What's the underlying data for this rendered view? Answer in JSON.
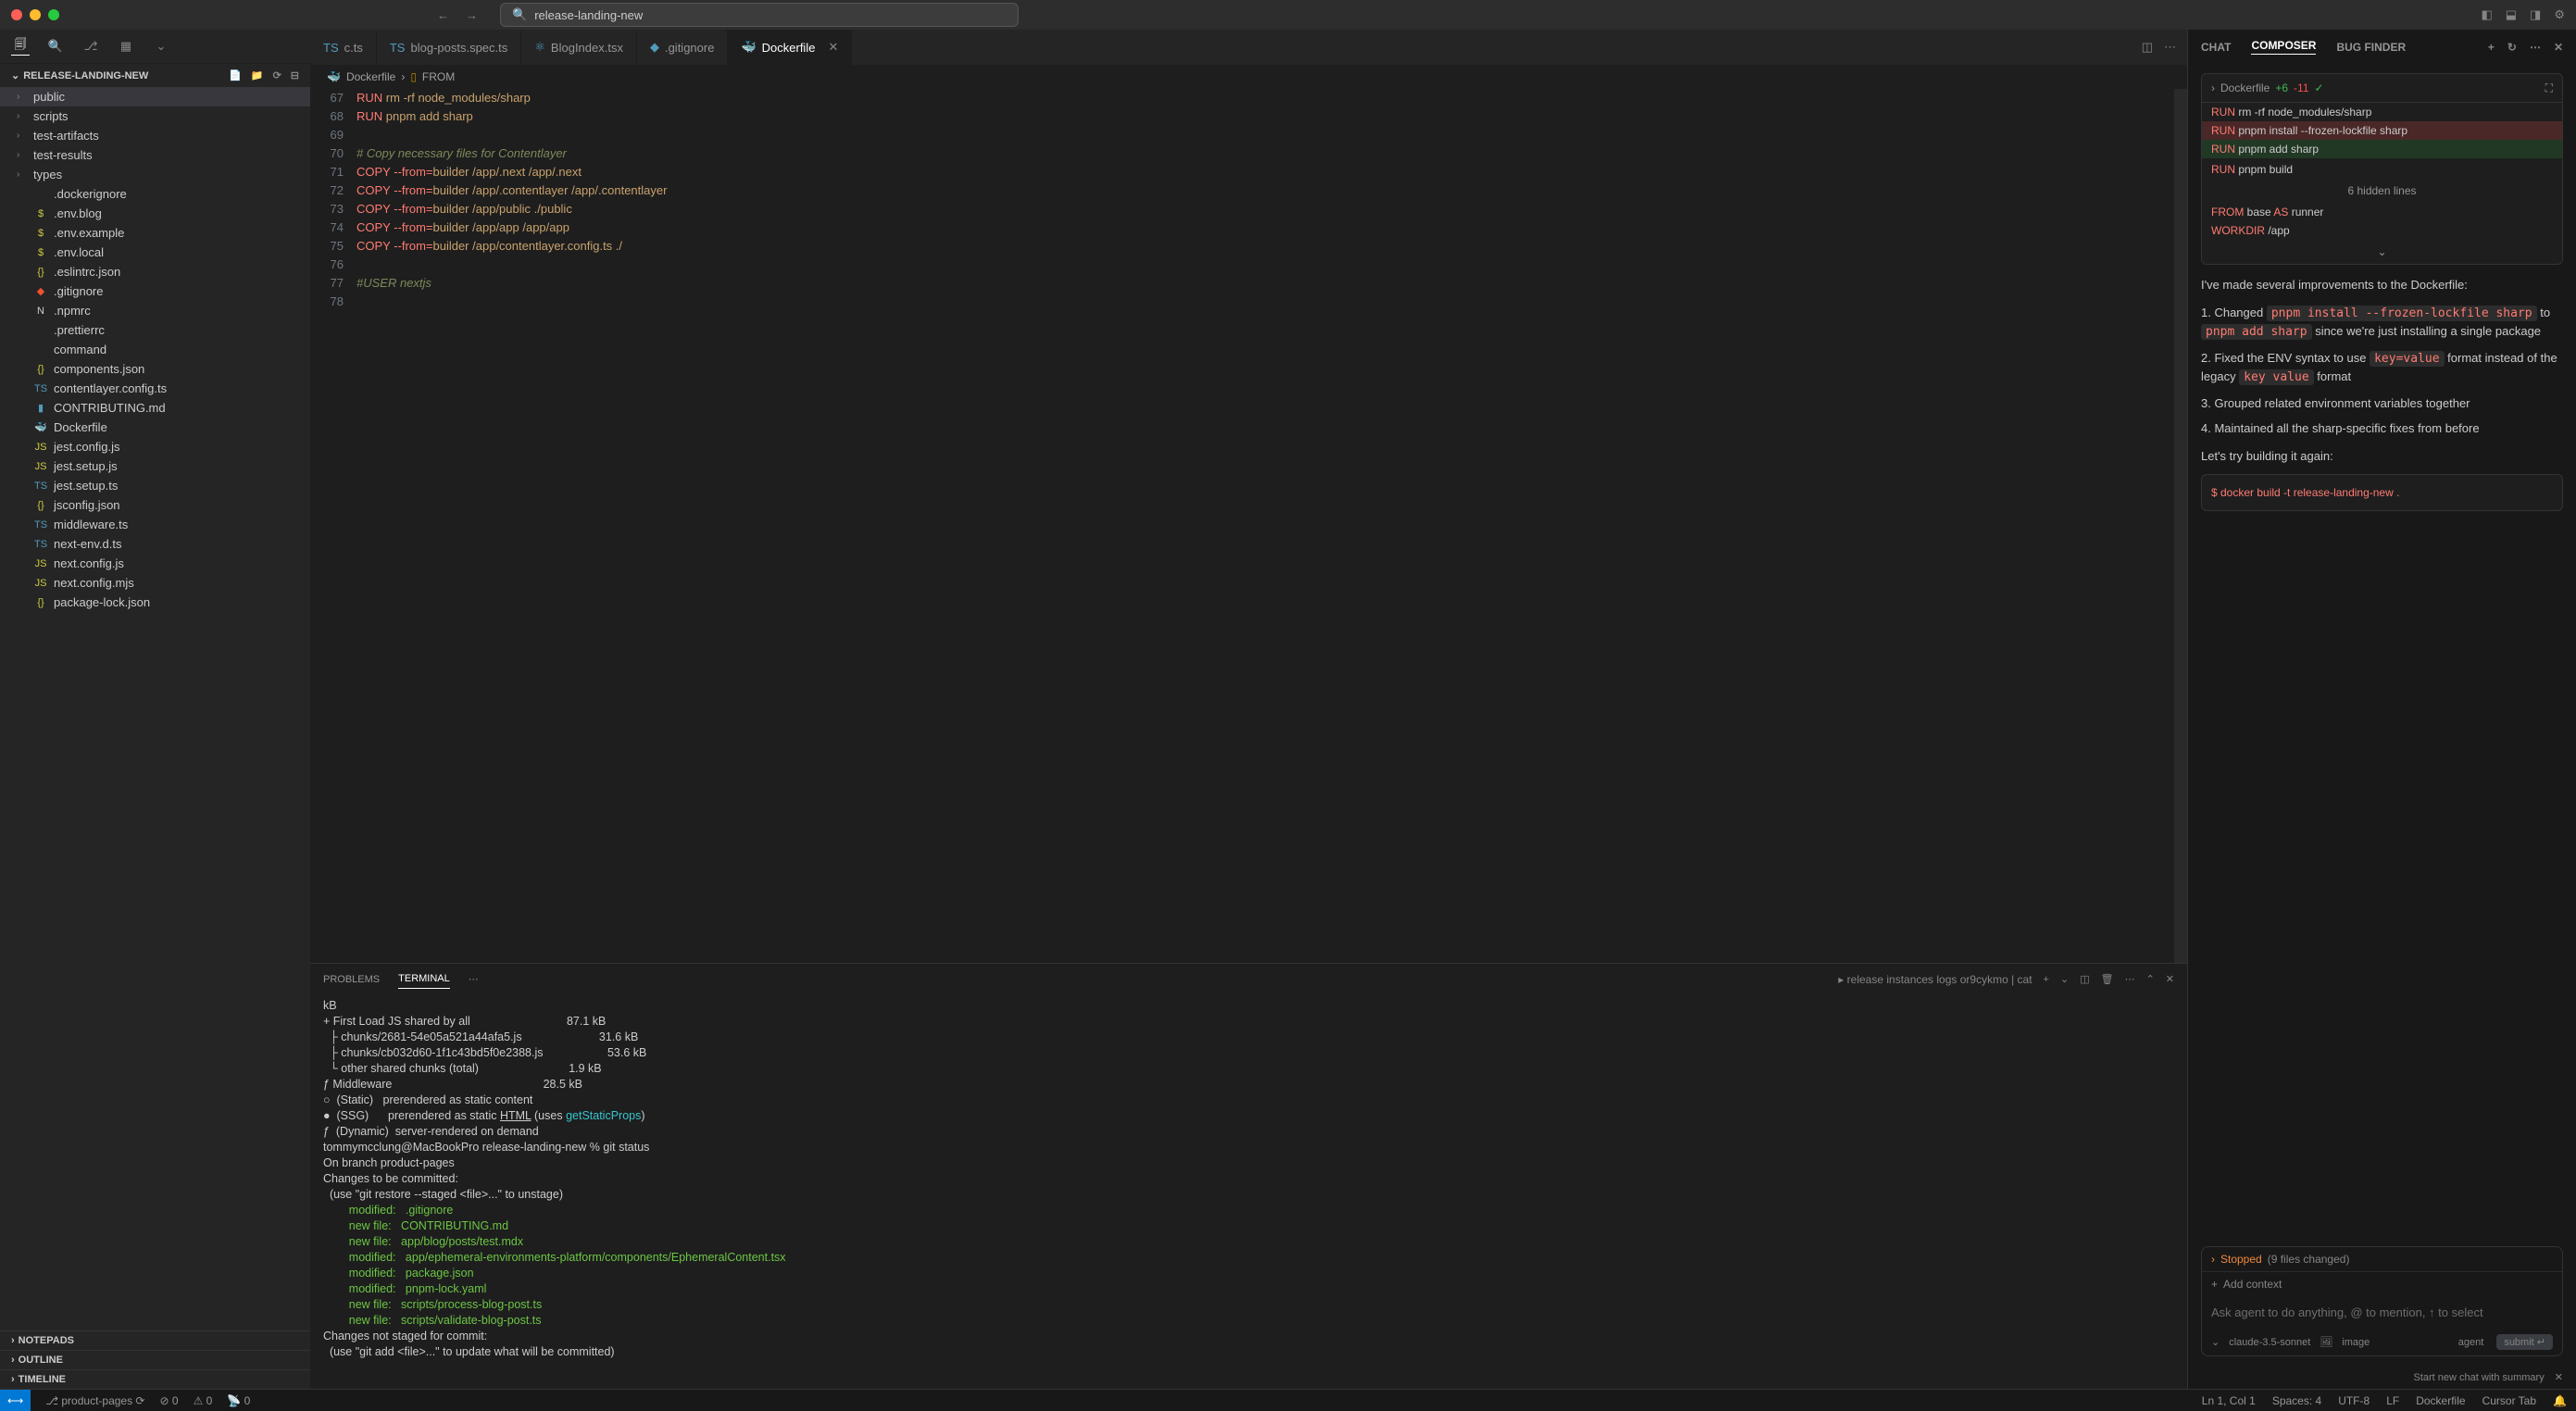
{
  "titlebar": {
    "search": "release-landing-new"
  },
  "explorer": {
    "title": "RELEASE-LANDING-NEW",
    "folders": [
      "public",
      "scripts",
      "test-artifacts",
      "test-results",
      "types"
    ],
    "files": [
      {
        "name": ".dockerignore",
        "icon": "",
        "color": ""
      },
      {
        "name": ".env.blog",
        "icon": "$",
        "color": "dollar"
      },
      {
        "name": ".env.example",
        "icon": "$",
        "color": "dollar"
      },
      {
        "name": ".env.local",
        "icon": "$",
        "color": "dollar"
      },
      {
        "name": ".eslintrc.json",
        "icon": "{}",
        "color": "json-y"
      },
      {
        "name": ".gitignore",
        "icon": "◆",
        "color": "git-orange"
      },
      {
        "name": ".npmrc",
        "icon": "N",
        "color": ""
      },
      {
        "name": ".prettierrc",
        "icon": "",
        "color": ""
      },
      {
        "name": "command",
        "icon": "",
        "color": ""
      },
      {
        "name": "components.json",
        "icon": "{}",
        "color": "json-y"
      },
      {
        "name": "contentlayer.config.ts",
        "icon": "TS",
        "color": "ts-blue"
      },
      {
        "name": "CONTRIBUTING.md",
        "icon": "▮",
        "color": "md-blue"
      },
      {
        "name": "Dockerfile",
        "icon": "🐳",
        "color": "docker-blue"
      },
      {
        "name": "jest.config.js",
        "icon": "JS",
        "color": "js-yellow"
      },
      {
        "name": "jest.setup.js",
        "icon": "JS",
        "color": "js-yellow"
      },
      {
        "name": "jest.setup.ts",
        "icon": "TS",
        "color": "ts-blue"
      },
      {
        "name": "jsconfig.json",
        "icon": "{}",
        "color": "json-y"
      },
      {
        "name": "middleware.ts",
        "icon": "TS",
        "color": "ts-blue"
      },
      {
        "name": "next-env.d.ts",
        "icon": "TS",
        "color": "ts-blue"
      },
      {
        "name": "next.config.js",
        "icon": "JS",
        "color": "js-yellow"
      },
      {
        "name": "next.config.mjs",
        "icon": "JS",
        "color": "js-yellow"
      },
      {
        "name": "package-lock.json",
        "icon": "{}",
        "color": "json-y"
      }
    ],
    "sections": [
      "NOTEPADS",
      "OUTLINE",
      "TIMELINE"
    ]
  },
  "tabs": [
    {
      "name": "c.ts",
      "icon": "TS"
    },
    {
      "name": "blog-posts.spec.ts",
      "icon": "TS"
    },
    {
      "name": "BlogIndex.tsx",
      "icon": "⚛"
    },
    {
      "name": ".gitignore",
      "icon": "◆"
    },
    {
      "name": "Dockerfile",
      "icon": "🐳",
      "active": true
    }
  ],
  "breadcrumb": {
    "file": "Dockerfile",
    "symbol": "FROM"
  },
  "code": {
    "start": 66,
    "lines": [
      {
        "n": 67,
        "html": "<span class='kw'>RUN</span> <span class='str'>rm -rf node_modules/sharp</span>"
      },
      {
        "n": 68,
        "html": "<span class='kw'>RUN</span> <span class='str'>pnpm add sharp</span>"
      },
      {
        "n": 69,
        "html": ""
      },
      {
        "n": 70,
        "html": "<span class='cmt'># Copy necessary files for Contentlayer</span>"
      },
      {
        "n": 71,
        "html": "<span class='kw'>COPY</span> <span class='op'>--from=</span><span class='str'>builder</span> <span class='str'>/app/.next /app/.next</span>"
      },
      {
        "n": 72,
        "html": "<span class='kw'>COPY</span> <span class='op'>--from=</span><span class='str'>builder</span> <span class='str'>/app/.contentlayer /app/.contentlayer</span>"
      },
      {
        "n": 73,
        "html": "<span class='kw'>COPY</span> <span class='op'>--from=</span><span class='str'>builder</span> <span class='str'>/app/public ./public</span>"
      },
      {
        "n": 74,
        "html": "<span class='kw'>COPY</span> <span class='op'>--from=</span><span class='str'>builder</span> <span class='str'>/app/app /app/app</span>"
      },
      {
        "n": 75,
        "html": "<span class='kw'>COPY</span> <span class='op'>--from=</span><span class='str'>builder</span> <span class='str'>/app/contentlayer.config.ts ./</span>"
      },
      {
        "n": 76,
        "html": ""
      },
      {
        "n": 77,
        "html": "<span class='cmt'>#USER nextjs</span>"
      },
      {
        "n": 78,
        "html": ""
      }
    ]
  },
  "panel": {
    "tabs": [
      "PROBLEMS",
      "TERMINAL"
    ],
    "active": "TERMINAL",
    "shell_label": "release instances logs or9cykmo | cat",
    "terminal": [
      {
        "t": "kB",
        "c": ""
      },
      {
        "t": "+ First Load JS shared by all                              87.1 kB",
        "c": ""
      },
      {
        "t": "  ├ chunks/2681-54e05a521a44afa5.js                        31.6 kB",
        "c": ""
      },
      {
        "t": "  ├ chunks/cb032d60-1f1c43bd5f0e2388.js                    53.6 kB",
        "c": ""
      },
      {
        "t": "  └ other shared chunks (total)                            1.9 kB",
        "c": ""
      },
      {
        "t": "",
        "c": ""
      },
      {
        "t": "ƒ Middleware                                               28.5 kB",
        "c": ""
      },
      {
        "t": "",
        "c": ""
      },
      {
        "t": "○  (Static)   prerendered as static content",
        "c": ""
      },
      {
        "t": "●  (SSG)      prerendered as static HTML (uses getStaticProps)",
        "c": "",
        "u": true
      },
      {
        "t": "ƒ  (Dynamic)  server-rendered on demand",
        "c": ""
      },
      {
        "t": "",
        "c": ""
      },
      {
        "t": "tommymcclung@MacBookPro release-landing-new % git status",
        "c": ""
      },
      {
        "t": "On branch product-pages",
        "c": ""
      },
      {
        "t": "Changes to be committed:",
        "c": ""
      },
      {
        "t": "  (use \"git restore --staged <file>...\" to unstage)",
        "c": ""
      },
      {
        "t": "        modified:   .gitignore",
        "c": "term-green"
      },
      {
        "t": "        new file:   CONTRIBUTING.md",
        "c": "term-green"
      },
      {
        "t": "        new file:   app/blog/posts/test.mdx",
        "c": "term-green"
      },
      {
        "t": "        modified:   app/ephemeral-environments-platform/components/EphemeralContent.tsx",
        "c": "term-green"
      },
      {
        "t": "        modified:   package.json",
        "c": "term-green"
      },
      {
        "t": "        modified:   pnpm-lock.yaml",
        "c": "term-green"
      },
      {
        "t": "        new file:   scripts/process-blog-post.ts",
        "c": "term-green"
      },
      {
        "t": "        new file:   scripts/validate-blog-post.ts",
        "c": "term-green"
      },
      {
        "t": "",
        "c": ""
      },
      {
        "t": "Changes not staged for commit:",
        "c": ""
      },
      {
        "t": "  (use \"git add <file>...\" to update what will be committed)",
        "c": ""
      }
    ]
  },
  "chat": {
    "tabs": [
      "CHAT",
      "COMPOSER",
      "BUG FINDER"
    ],
    "active": "COMPOSER",
    "diff_header": {
      "file": "Dockerfile",
      "add": "+6",
      "del": "-11"
    },
    "diff_lines": [
      {
        "t": "RUN rm -rf node_modules/sharp",
        "c": ""
      },
      {
        "t": "RUN pnpm install --frozen-lockfile sharp",
        "c": "diff-del"
      },
      {
        "t": "RUN pnpm add sharp",
        "c": "diff-add"
      },
      {
        "t": "",
        "c": ""
      },
      {
        "t": "RUN pnpm build",
        "c": ""
      }
    ],
    "hidden": "6 hidden lines",
    "diff2": [
      {
        "t": "FROM base AS runner",
        "c": ""
      },
      {
        "t": "WORKDIR /app",
        "c": ""
      }
    ],
    "msg_intro": "I've made several improvements to the Dockerfile:",
    "items": [
      {
        "pre": "1. Changed ",
        "c1": "pnpm install --frozen-lockfile sharp",
        "mid": " to ",
        "c2": "pnpm add sharp",
        "post": " since we're just installing a single package"
      },
      {
        "pre": "2. Fixed the ENV syntax to use ",
        "c1": "key=value",
        "mid": " format instead of the legacy ",
        "c2": "key value",
        "post": " format"
      },
      {
        "pre": "3. Grouped related environment variables together"
      },
      {
        "pre": "4. Maintained all the sharp-specific fixes from before"
      }
    ],
    "try": "Let's try building it again:",
    "cmd": "$ docker build -t release-landing-new .",
    "stopped": "Stopped",
    "files_changed": "(9 files changed)",
    "add_context": "Add context",
    "placeholder": "Ask agent to do anything, @ to mention, ↑ to select",
    "model": "claude-3.5-sonnet",
    "image_label": "image",
    "agent": "agent",
    "submit": "submit",
    "summary": "Start new chat with summary"
  },
  "status": {
    "branch": "product-pages",
    "errors": "0",
    "warnings": "0",
    "ports": "0",
    "position": "Ln 1, Col 1",
    "spaces": "Spaces: 4",
    "encoding": "UTF-8",
    "eol": "LF",
    "lang": "Dockerfile",
    "cursor": "Cursor Tab"
  }
}
